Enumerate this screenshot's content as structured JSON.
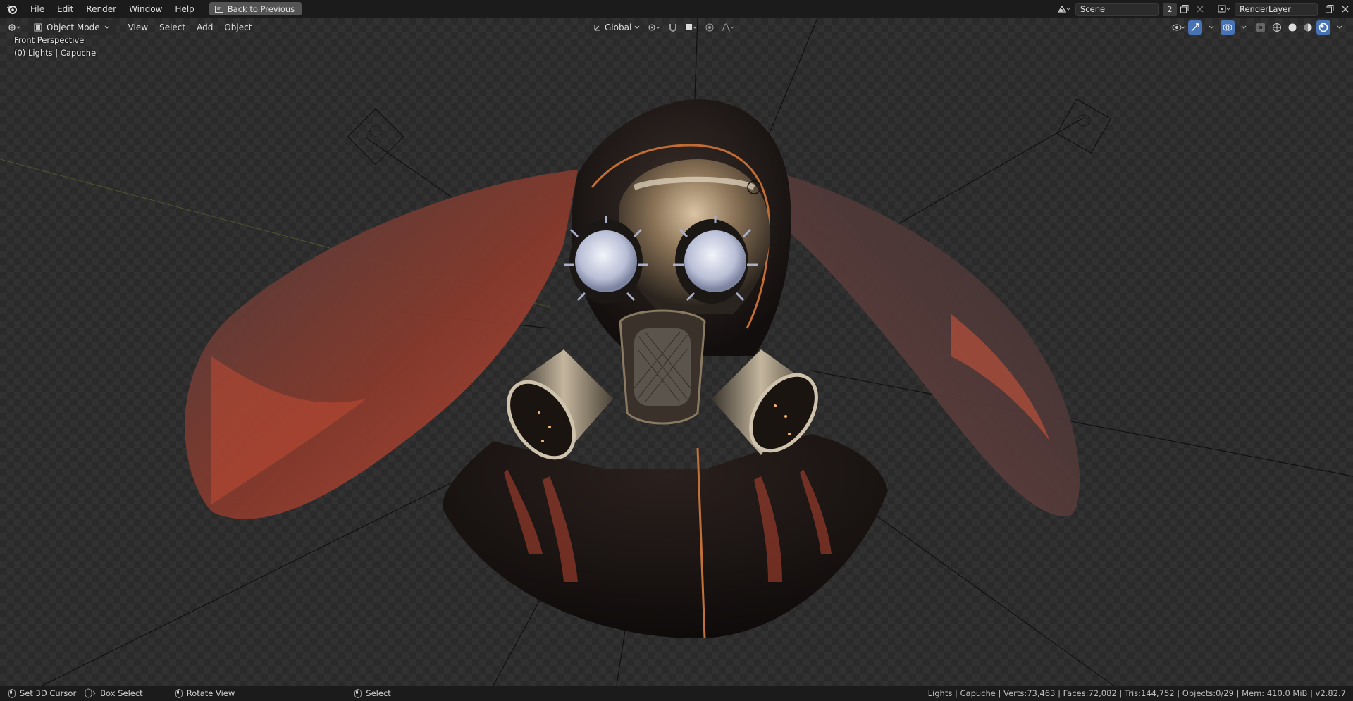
{
  "topbar": {
    "logo_icon": "blender-logo-icon",
    "menus": [
      "File",
      "Edit",
      "Render",
      "Window",
      "Help"
    ],
    "back_button": "Back to Previous",
    "scene_label": "Scene",
    "scene_users": "2",
    "render_layer": "RenderLayer"
  },
  "viewport_header": {
    "mode": "Object Mode",
    "menus": [
      "View",
      "Select",
      "Add",
      "Object"
    ],
    "transform_orientation": "Global"
  },
  "viewport": {
    "view_name": "Front Perspective",
    "object_info": "(0) Lights | Capuche",
    "accent": "#4772b3"
  },
  "statusbar": {
    "set_cursor": "Set 3D Cursor",
    "box_select": "Box Select",
    "rotate_view": "Rotate View",
    "select": "Select",
    "stats": "Lights | Capuche | Verts:73,463 | Faces:72,082 | Tris:144,752 | Objects:0/29 | Mem: 410.0 MiB | v2.82.7"
  }
}
